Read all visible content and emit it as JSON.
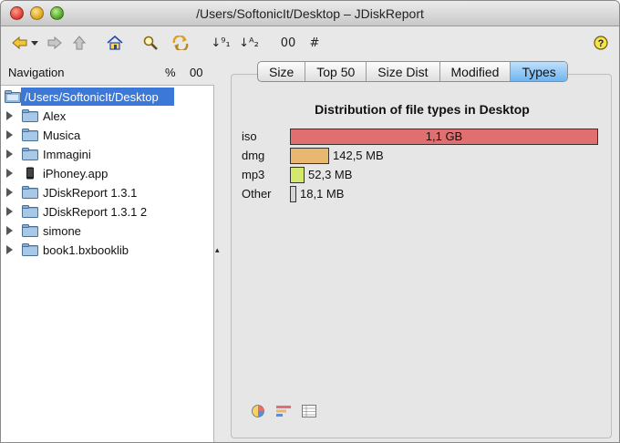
{
  "window": {
    "title": "/Users/SoftonicIt/Desktop – JDiskReport"
  },
  "toolbar": {
    "back_icon": "back-arrow-icon",
    "forward_icon": "forward-arrow-icon",
    "up_icon": "up-arrow-icon",
    "home_icon": "home-icon",
    "search_icon": "magnifier-icon",
    "refresh_icon": "reload-icon",
    "sort_numeric": "↓⁹₁",
    "sort_alpha": "↓ᴬ₂",
    "view_oo": "00",
    "view_hash": "#",
    "help_icon": "help-icon"
  },
  "navigation": {
    "title": "Navigation",
    "percent_label": "%",
    "oo_label": "00",
    "root": "/Users/SoftonicIt/Desktop",
    "items": [
      {
        "label": "Alex",
        "icon": "folder-icon"
      },
      {
        "label": "Musica",
        "icon": "folder-icon"
      },
      {
        "label": "Immagini",
        "icon": "folder-icon"
      },
      {
        "label": "iPhoney.app",
        "icon": "phone-icon"
      },
      {
        "label": "JDiskReport 1.3.1",
        "icon": "folder-icon"
      },
      {
        "label": "JDiskReport 1.3.1 2",
        "icon": "folder-icon"
      },
      {
        "label": "simone",
        "icon": "folder-icon"
      },
      {
        "label": "book1.bxbooklib",
        "icon": "folder-icon"
      }
    ]
  },
  "tabs": {
    "items": [
      "Size",
      "Top 50",
      "Size Dist",
      "Modified",
      "Types"
    ],
    "active": "Types"
  },
  "chart_data": {
    "type": "bar",
    "title": "Distribution of file types in Desktop",
    "categories": [
      "iso",
      "dmg",
      "mp3",
      "Other"
    ],
    "values": [
      1126.4,
      142.5,
      52.3,
      18.1
    ],
    "units": "MB",
    "value_labels": [
      "1,1 GB",
      "142,5 MB",
      "52,3 MB",
      "18,1 MB"
    ],
    "colors": [
      "#e07070",
      "#e8b870",
      "#d4e870",
      "#d6d6d6"
    ],
    "orientation": "horizontal",
    "grid": false
  },
  "bottom_icons": [
    "pie-chart-icon",
    "bar-chart-icon",
    "table-icon"
  ]
}
